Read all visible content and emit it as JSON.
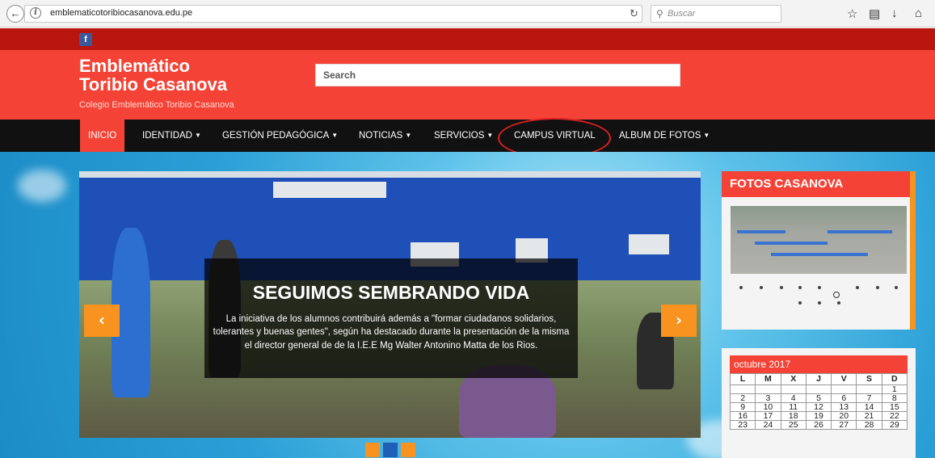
{
  "browser": {
    "url": "emblematicotoribiocasanova.edu.pe",
    "search_placeholder": "Buscar"
  },
  "site": {
    "title_line1": "Emblemático",
    "title_line2": "Toribio Casanova",
    "subtitle": "Colegio Emblemático Toribio Casanova",
    "search_placeholder": "Search",
    "colors": {
      "header": "#f44336",
      "topstrip": "#b8160e",
      "nav": "#111111",
      "accent": "#f7931e"
    }
  },
  "nav": {
    "items": [
      {
        "label": "INICIO",
        "active": true
      },
      {
        "label": "IDENTIDAD",
        "dropdown": true
      },
      {
        "label": "GESTIÓN PEDAGÓGICA",
        "dropdown": true
      },
      {
        "label": "NOTICIAS",
        "dropdown": true
      },
      {
        "label": "SERVICIOS",
        "dropdown": true
      },
      {
        "label": "CAMPUS VIRTUAL",
        "highlighted": true
      },
      {
        "label": "ALBUM DE FOTOS",
        "dropdown": true
      }
    ]
  },
  "slider": {
    "title": "SEGUIMOS SEMBRANDO VIDA",
    "text": "La iniciativa de los alumnos contribuirá además a \"formar ciudadanos solidarios, tolerantes y buenas gentes\", según ha destacado durante la presentación de la misma el director general de de la I.E.E Mg Walter Antonino Matta de los Rios.",
    "prev_label": "‹",
    "next_label": "›"
  },
  "sidebar": {
    "photos_title": "FOTOS CASANOVA",
    "calendar": {
      "month": "octubre 2017",
      "days": [
        "L",
        "M",
        "X",
        "J",
        "V",
        "S",
        "D"
      ],
      "weeks": [
        [
          "",
          "",
          "",
          "",
          "",
          "",
          "1"
        ],
        [
          "2",
          "3",
          "4",
          "5",
          "6",
          "7",
          "8"
        ],
        [
          "9",
          "10",
          "11",
          "12",
          "13",
          "14",
          "15"
        ],
        [
          "16",
          "17",
          "18",
          "19",
          "20",
          "21",
          "22"
        ],
        [
          "23",
          "24",
          "25",
          "26",
          "27",
          "28",
          "29"
        ]
      ]
    }
  }
}
